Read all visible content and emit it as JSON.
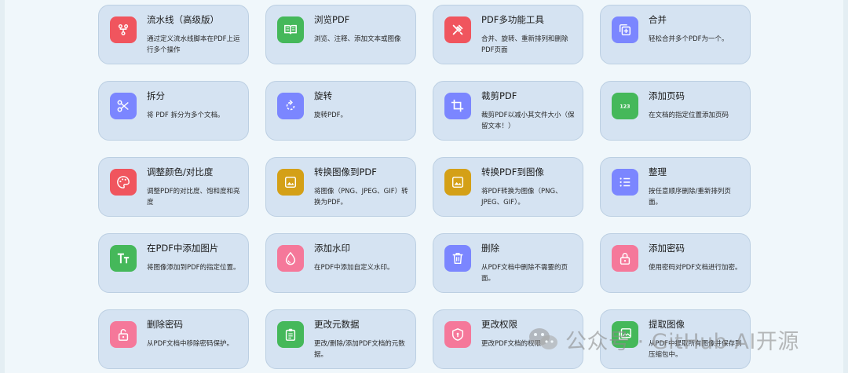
{
  "tools": [
    {
      "title": "流水线（高级版）",
      "desc": "通过定义流水线脚本在PDF上运行多个操作",
      "icon": "pipeline-icon",
      "color": "#f0555e"
    },
    {
      "title": "浏览PDF",
      "desc": "浏览、注释、添加文本或图像",
      "icon": "book-icon",
      "color": "#45b85a"
    },
    {
      "title": "PDF多功能工具",
      "desc": "合并、旋转、重新排列和删除PDF页面",
      "icon": "tools-icon",
      "color": "#f0555e"
    },
    {
      "title": "合并",
      "desc": "轻松合并多个PDF为一个。",
      "icon": "merge-icon",
      "color": "#7b86ff"
    },
    {
      "title": "拆分",
      "desc": "将 PDF 拆分为多个文档。",
      "icon": "scissors-icon",
      "color": "#7b86ff"
    },
    {
      "title": "旋转",
      "desc": "旋转PDF。",
      "icon": "rotate-icon",
      "color": "#7b86ff"
    },
    {
      "title": "裁剪PDF",
      "desc": "裁剪PDF以减小其文件大小（保留文本！）",
      "icon": "crop-icon",
      "color": "#7b86ff"
    },
    {
      "title": "添加页码",
      "desc": "在文档的指定位置添加页码",
      "icon": "page-numbers-icon",
      "color": "#45b85a"
    },
    {
      "title": "调整颜色/对比度",
      "desc": "调整PDF的对比度、饱和度和亮度",
      "icon": "palette-icon",
      "color": "#f0555e"
    },
    {
      "title": "转换图像到PDF",
      "desc": "将图像（PNG、JPEG、GIF）转换为PDF。",
      "icon": "image-icon",
      "color": "#d4a017"
    },
    {
      "title": "转换PDF到图像",
      "desc": "将PDF转换为图像（PNG、JPEG、GIF）。",
      "icon": "image-icon",
      "color": "#d4a017"
    },
    {
      "title": "整理",
      "desc": "按任意顺序删除/重新排列页面。",
      "icon": "list-icon",
      "color": "#7b86ff"
    },
    {
      "title": "在PDF中添加图片",
      "desc": "将图像添加到PDF的指定位置。",
      "icon": "text-size-icon",
      "color": "#45b85a"
    },
    {
      "title": "添加水印",
      "desc": "在PDF中添加自定义水印。",
      "icon": "droplet-icon",
      "color": "#f5789a"
    },
    {
      "title": "删除",
      "desc": "从PDF文档中删除不需要的页面。",
      "icon": "trash-icon",
      "color": "#7b86ff"
    },
    {
      "title": "添加密码",
      "desc": "使用密码对PDF文档进行加密。",
      "icon": "lock-icon",
      "color": "#f5789a"
    },
    {
      "title": "删除密码",
      "desc": "从PDF文档中移除密码保护。",
      "icon": "unlock-icon",
      "color": "#f5789a"
    },
    {
      "title": "更改元数据",
      "desc": "更改/删除/添加PDF文档的元数据。",
      "icon": "clipboard-icon",
      "color": "#45b85a"
    },
    {
      "title": "更改权限",
      "desc": "更改PDF文档的权限",
      "icon": "shield-icon",
      "color": "#f5789a"
    },
    {
      "title": "提取图像",
      "desc": "从PDF中提取所有图像并保存到压缩包中。",
      "icon": "images-icon",
      "color": "#45b85a"
    }
  ],
  "watermark": {
    "text": "公众号 · GitHub AI开源"
  }
}
